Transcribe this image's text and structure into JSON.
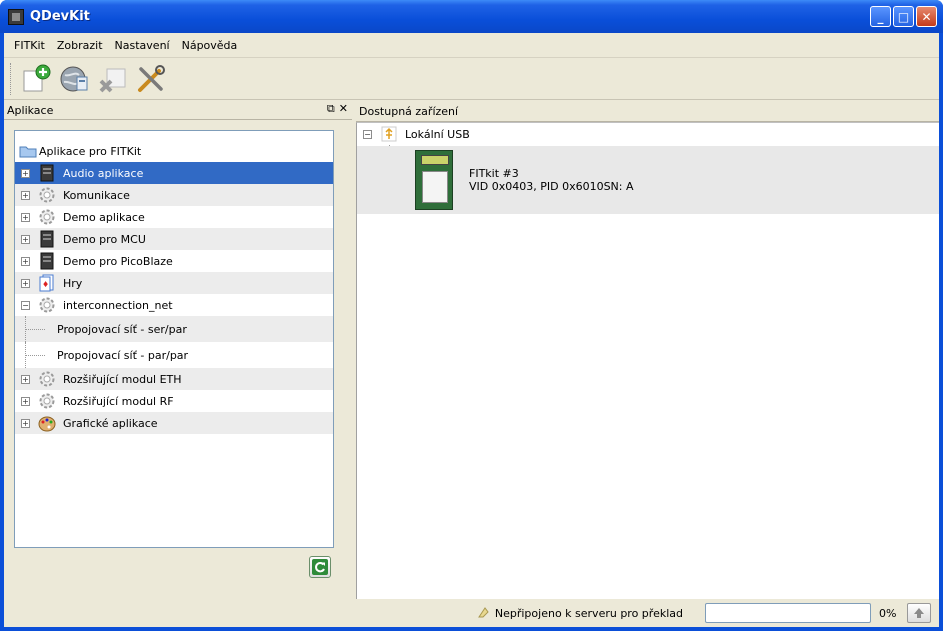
{
  "window": {
    "title": "QDevKit"
  },
  "menu": [
    "FITKit",
    "Zobrazit",
    "Nastavení",
    "Nápověda"
  ],
  "toolbar": {
    "buttons": [
      {
        "icon": "new-project-icon"
      },
      {
        "icon": "globe-connect-icon"
      },
      {
        "icon": "disconnect-icon"
      },
      {
        "icon": "tools-icon"
      }
    ]
  },
  "left_panel": {
    "title": "Aplikace",
    "root": "Aplikace pro FITKit",
    "items": [
      {
        "label": "Audio aplikace",
        "icon": "chip-icon",
        "expander": "+",
        "selected": true
      },
      {
        "label": "Komunikace",
        "icon": "gear-icon",
        "expander": "+"
      },
      {
        "label": "Demo aplikace",
        "icon": "gear-icon",
        "expander": "+"
      },
      {
        "label": "Demo pro MCU",
        "icon": "chip-icon",
        "expander": "+"
      },
      {
        "label": "Demo pro PicoBlaze",
        "icon": "chip-icon",
        "expander": "+"
      },
      {
        "label": "Hry",
        "icon": "cards-icon",
        "expander": "+"
      },
      {
        "label": "interconnection_net",
        "icon": "gear-icon",
        "expander": "−"
      },
      {
        "label": "Propojovací síť - ser/par",
        "child": true
      },
      {
        "label": "Propojovací síť - par/par",
        "child": true
      },
      {
        "label": "Rozšiřující modul ETH",
        "icon": "gear-icon",
        "expander": "+"
      },
      {
        "label": "Rozšiřující modul RF",
        "icon": "gear-icon",
        "expander": "+"
      },
      {
        "label": "Grafické aplikace",
        "icon": "palette-icon",
        "expander": "+"
      }
    ]
  },
  "right_panel": {
    "title": "Dostupná zařízení",
    "usb_label": "Lokální USB",
    "device": {
      "name": "FITkit #3",
      "details": "VID 0x0403, PID 0x6010SN: A"
    }
  },
  "status": {
    "text": "Nepřipojeno k serveru pro překlad",
    "progress_percent": 0,
    "progress_label": "0%"
  },
  "colors": {
    "selection": "#316ac5",
    "titlebar": "#0a4fd9",
    "client": "#ece9d8"
  }
}
